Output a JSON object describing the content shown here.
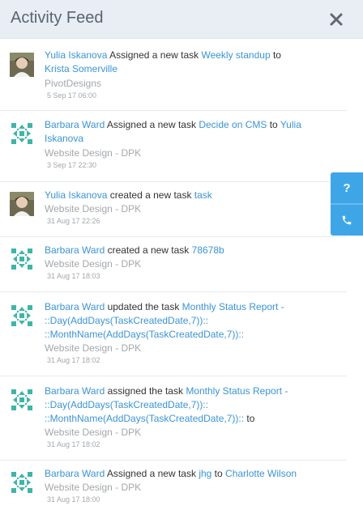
{
  "header": {
    "title": "Activity Feed",
    "close_icon": "close-icon"
  },
  "feed": [
    {
      "avatar": "photo",
      "actor": "Yulia Iskanova",
      "action": " Assigned a new task ",
      "task": "Weekly standup",
      "joiner": " to ",
      "target": "Krista Somerville",
      "trailing": "",
      "project": "PivotDesigns",
      "date": "5 Sep 17 06:00"
    },
    {
      "avatar": "pattern",
      "actor": "Barbara Ward",
      "action": " Assigned a new task ",
      "task": "Decide on CMS",
      "joiner": " to ",
      "target": "Yulia Iskanova",
      "trailing": "",
      "project": "Website Design - DPK",
      "date": "3 Sep 17 22:30"
    },
    {
      "avatar": "photo",
      "actor": "Yulia Iskanova",
      "action": " created a new task ",
      "task": "task",
      "joiner": "",
      "target": "",
      "trailing": "",
      "project": "Website Design - DPK",
      "date": "31 Aug 17 22:26"
    },
    {
      "avatar": "pattern",
      "actor": "Barbara Ward",
      "action": " created a new task ",
      "task": "78678b",
      "joiner": "",
      "target": "",
      "trailing": "",
      "project": "Website Design - DPK",
      "date": "31 Aug 17 18:03"
    },
    {
      "avatar": "pattern",
      "actor": "Barbara Ward",
      "action": " updated the task ",
      "task": "Monthly Status Report - ::Day(AddDays(TaskCreatedDate,7)):: ::MonthName(AddDays(TaskCreatedDate,7))::",
      "joiner": "",
      "target": "",
      "trailing": "",
      "project": "Website Design - DPK",
      "date": "31 Aug 17 18:02"
    },
    {
      "avatar": "pattern",
      "actor": "Barbara Ward",
      "action": " assigned the task ",
      "task": "Monthly Status Report - ::Day(AddDays(TaskCreatedDate,7)):: ::MonthName(AddDays(TaskCreatedDate,7))::",
      "joiner": "",
      "target": "",
      "trailing": " to",
      "project": "Website Design - DPK",
      "date": "31 Aug 17 18:02"
    },
    {
      "avatar": "pattern",
      "actor": "Barbara Ward",
      "action": " Assigned a new task ",
      "task": "jhg",
      "joiner": " to ",
      "target": "Charlotte Wilson",
      "trailing": "",
      "project": "Website Design - DPK",
      "date": "31 Aug 17 18:00"
    }
  ],
  "side_buttons": {
    "help_label": "?",
    "help_icon": "question-icon",
    "phone_icon": "phone-icon"
  },
  "colors": {
    "link": "#3b94d5",
    "muted": "#a3a7ab",
    "accent": "#3ea6e6",
    "header_bg": "#e8eef3"
  }
}
